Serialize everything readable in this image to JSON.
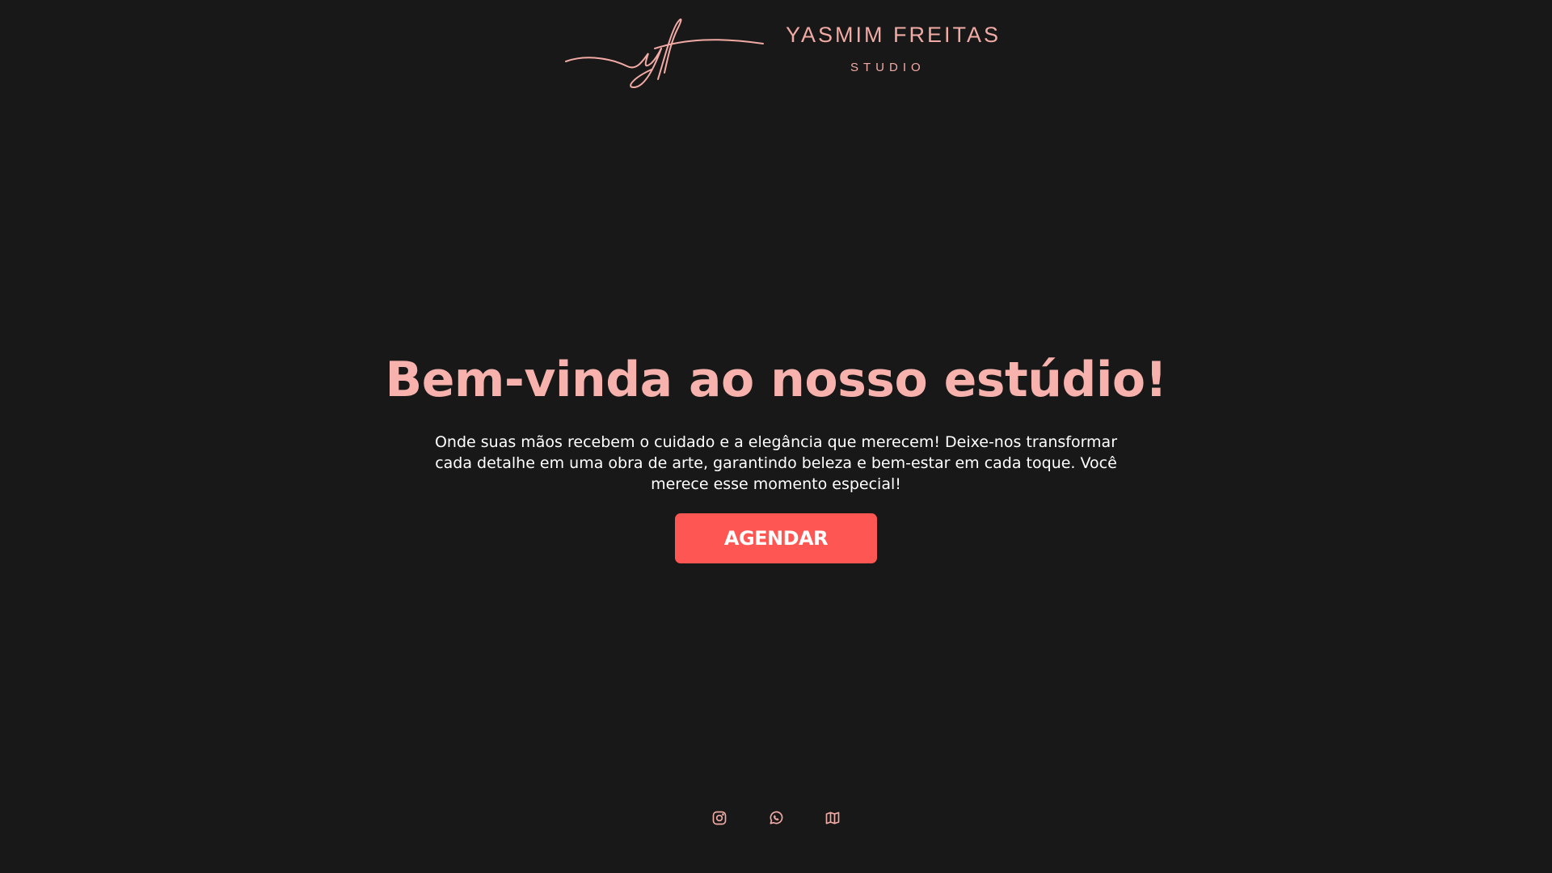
{
  "brand": {
    "name": "YASMIM FREITAS",
    "subtitle": "STUDIO",
    "monogram": "yf"
  },
  "hero": {
    "title": "Bem-vinda ao nosso estúdio!",
    "description": "Onde suas mãos recebem o cuidado e a elegância que merecem! Deixe-nos transformar cada detalhe em uma obra de arte, garantindo beleza e bem-estar em cada toque. Você merece esse momento especial!",
    "cta_label": "AGENDAR"
  },
  "social": [
    {
      "icon": "instagram-icon"
    },
    {
      "icon": "whatsapp-icon"
    },
    {
      "icon": "map-icon"
    }
  ],
  "colors": {
    "background": "#181818",
    "accent_pink": "#f7b2ad",
    "cta": "#fe5753",
    "text": "#ffffff"
  }
}
